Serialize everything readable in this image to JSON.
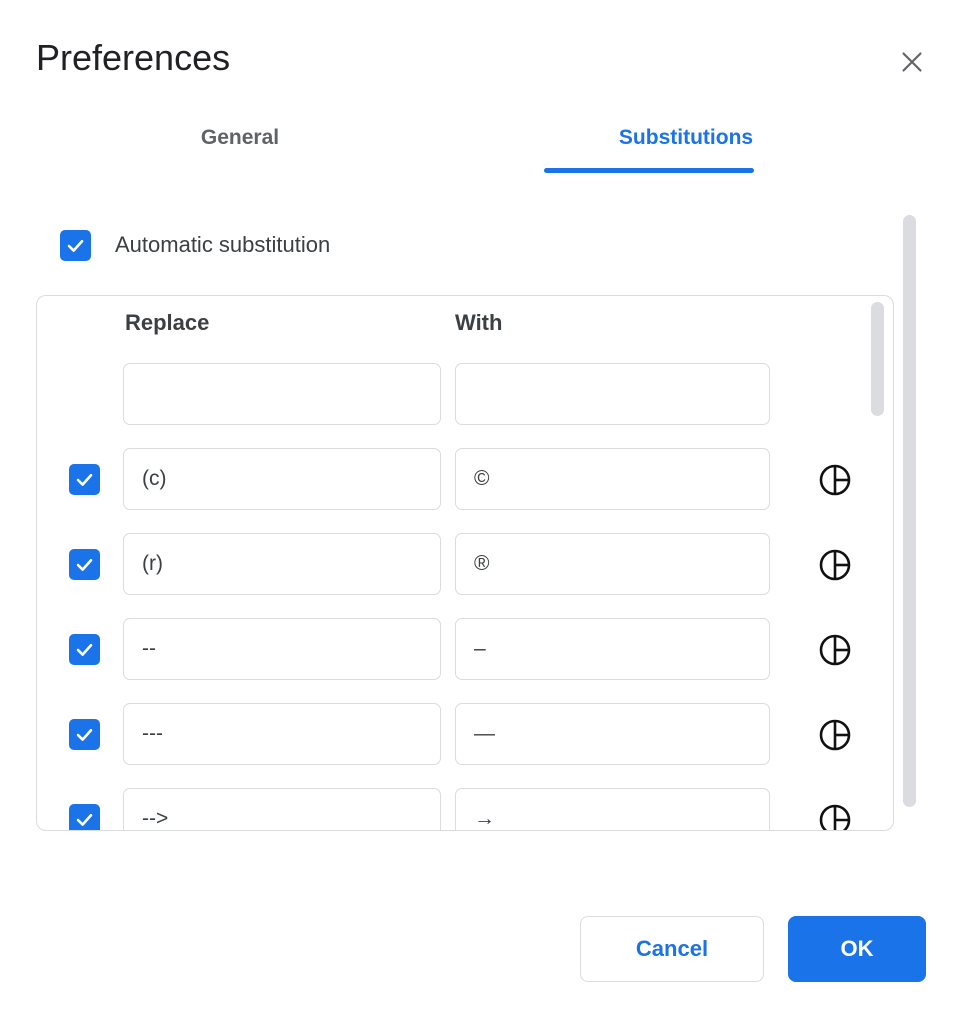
{
  "dialog": {
    "title": "Preferences",
    "close_icon": "close-icon"
  },
  "tabs": [
    {
      "label": "General",
      "active": false
    },
    {
      "label": "Substitutions",
      "active": true
    }
  ],
  "automatic_substitution": {
    "label": "Automatic substitution",
    "checked": true
  },
  "table": {
    "headers": {
      "replace": "Replace",
      "with": "With"
    },
    "rows": [
      {
        "checked": null,
        "replace": "",
        "with": "",
        "placeholder_replace": "",
        "placeholder_with": "",
        "action_icon": null
      },
      {
        "checked": true,
        "replace": "(c)",
        "with": "©",
        "action_icon": "delete-icon"
      },
      {
        "checked": true,
        "replace": "(r)",
        "with": "®",
        "action_icon": "delete-icon"
      },
      {
        "checked": true,
        "replace": "--",
        "with": "–",
        "action_icon": "delete-icon"
      },
      {
        "checked": true,
        "replace": "---",
        "with": "—",
        "action_icon": "delete-icon"
      },
      {
        "checked": true,
        "replace": "-->",
        "with": "→",
        "action_icon": "delete-icon"
      }
    ]
  },
  "footer": {
    "cancel_label": "Cancel",
    "ok_label": "OK"
  },
  "colors": {
    "accent": "#1a73e8",
    "text_primary": "#202124",
    "text_secondary": "#3c4043",
    "text_muted": "#5f6368",
    "border": "#dadce0",
    "scrollbar": "#dadce0",
    "surface": "#ffffff"
  }
}
